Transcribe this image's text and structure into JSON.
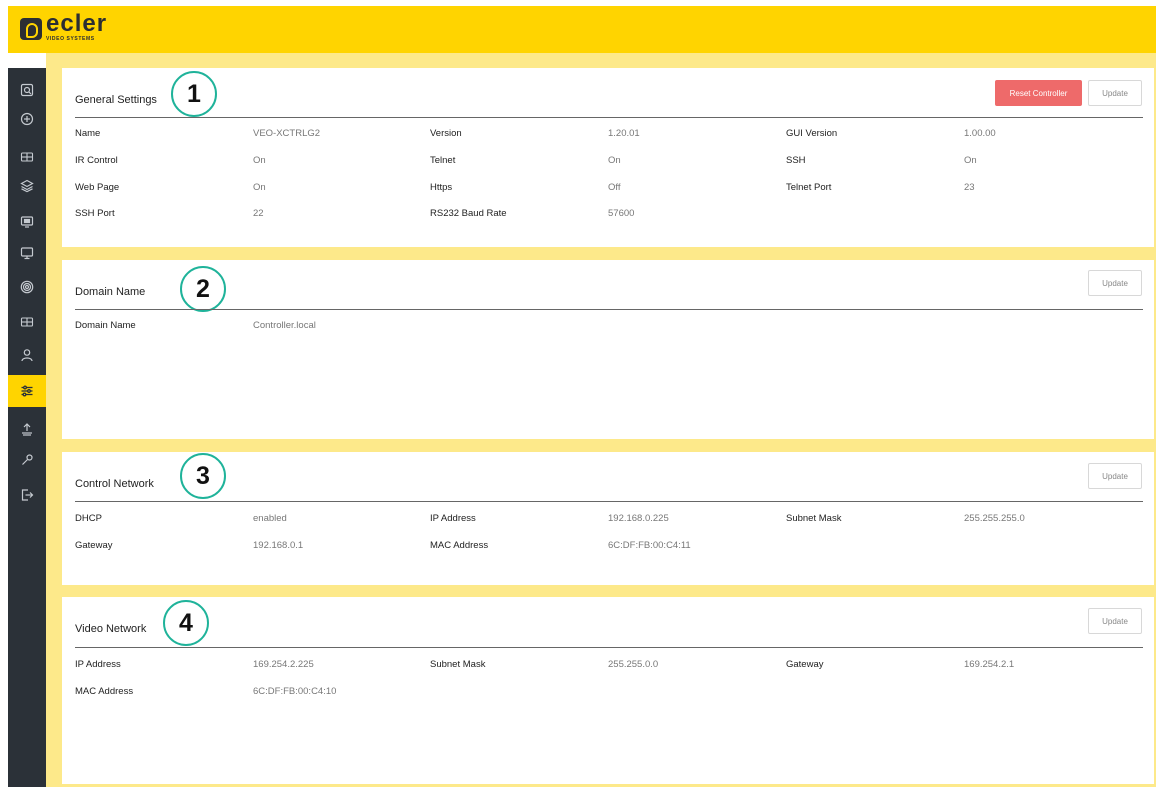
{
  "brand": {
    "name": "ecler",
    "subtitle": "VIDEO SYSTEMS"
  },
  "sidebar": {
    "items": [
      {
        "icon": "search-screen-icon",
        "active": false
      },
      {
        "icon": "add-circle-icon",
        "active": false
      },
      {
        "icon": "device-grid-icon",
        "active": false
      },
      {
        "icon": "layers-icon",
        "active": false
      },
      {
        "icon": "display-icon",
        "active": false
      },
      {
        "icon": "monitor-icon",
        "active": false
      },
      {
        "icon": "signal-icon",
        "active": false
      },
      {
        "icon": "device-grid-icon",
        "active": false
      },
      {
        "icon": "user-icon",
        "active": false
      },
      {
        "icon": "settings-sliders-icon",
        "active": true
      },
      {
        "icon": "upload-icon",
        "active": false
      },
      {
        "icon": "wrench-icon",
        "active": false
      },
      {
        "icon": "logout-icon",
        "active": false
      }
    ]
  },
  "general": {
    "number": "1",
    "title": "General Settings",
    "reset_label": "Reset Controller",
    "update_label": "Update",
    "rows": [
      [
        {
          "label": "Name",
          "value": "VEO-XCTRLG2"
        },
        {
          "label": "Version",
          "value": "1.20.01"
        },
        {
          "label": "GUI Version",
          "value": "1.00.00"
        }
      ],
      [
        {
          "label": "IR Control",
          "value": "On"
        },
        {
          "label": "Telnet",
          "value": "On"
        },
        {
          "label": "SSH",
          "value": "On"
        }
      ],
      [
        {
          "label": "Web Page",
          "value": "On"
        },
        {
          "label": "Https",
          "value": "Off"
        },
        {
          "label": "Telnet Port",
          "value": "23"
        }
      ],
      [
        {
          "label": "SSH Port",
          "value": "22"
        },
        {
          "label": "RS232 Baud Rate",
          "value": "57600"
        }
      ]
    ]
  },
  "domain": {
    "number": "2",
    "title": "Domain Name",
    "update_label": "Update",
    "rows": [
      [
        {
          "label": "Domain Name",
          "value": "Controller.local"
        }
      ]
    ]
  },
  "control": {
    "number": "3",
    "title": "Control Network",
    "update_label": "Update",
    "rows": [
      [
        {
          "label": "DHCP",
          "value": "enabled"
        },
        {
          "label": "IP Address",
          "value": "192.168.0.225"
        },
        {
          "label": "Subnet Mask",
          "value": "255.255.255.0"
        }
      ],
      [
        {
          "label": "Gateway",
          "value": "192.168.0.1"
        },
        {
          "label": "MAC Address",
          "value": "6C:DF:FB:00:C4:11"
        }
      ]
    ]
  },
  "video": {
    "number": "4",
    "title": "Video Network",
    "update_label": "Update",
    "rows": [
      [
        {
          "label": "IP Address",
          "value": "169.254.2.225"
        },
        {
          "label": "Subnet Mask",
          "value": "255.255.0.0"
        },
        {
          "label": "Gateway",
          "value": "169.254.2.1"
        }
      ],
      [
        {
          "label": "MAC Address",
          "value": "6C:DF:FB:00:C4:10"
        }
      ]
    ]
  },
  "colors": {
    "brand_yellow": "#ffd400",
    "sidebar_dark": "#2b3138",
    "badge_teal": "#1fb39a",
    "reset_red": "#ee6a6a"
  }
}
